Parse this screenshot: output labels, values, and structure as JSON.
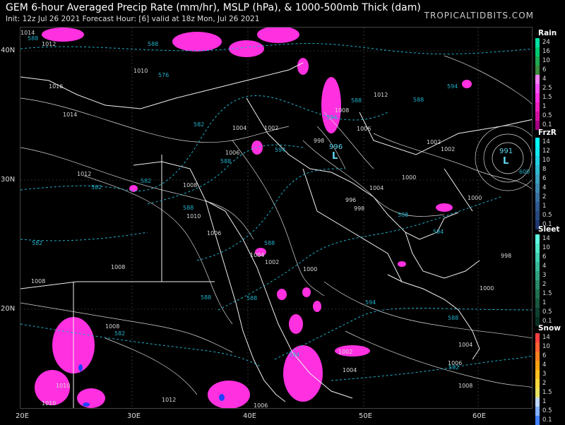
{
  "header": {
    "title": "GEM 6-hour Averaged Precip Rate (mm/hr), MSLP (hPa), & 1000-500mb Thick (dam)",
    "subtitle": "Init: 12z Jul 26 2021   Forecast Hour: [6]   valid at 18z Mon, Jul 26 2021",
    "brand": "TROPICALTIDBITS.COM"
  },
  "axes": {
    "lat_labels": [
      "40N",
      "30N",
      "20N"
    ],
    "lon_labels": [
      "20E",
      "30E",
      "40E",
      "50E",
      "60E"
    ]
  },
  "map_labels": {
    "pressure": [
      "1014",
      "1012",
      "1010",
      "1016",
      "1014",
      "1008",
      "1006",
      "1004",
      "1002",
      "1000",
      "998",
      "996",
      "1002",
      "1000",
      "1004",
      "1006",
      "1008",
      "1010",
      "1012",
      "1012",
      "1008",
      "1006",
      "1004",
      "1002",
      "1000",
      "998",
      "998",
      "1000",
      "1008",
      "1006",
      "1010",
      "1012",
      "1008",
      "1010",
      "1006",
      "1008",
      "1002",
      "1004",
      "1004",
      "1002"
    ],
    "thickness": [
      "576",
      "588",
      "582",
      "588",
      "582",
      "588",
      "594",
      "588",
      "594",
      "588",
      "594",
      "588",
      "582",
      "588",
      "594",
      "600",
      "588",
      "594",
      "588",
      "582",
      "582",
      "588",
      "594",
      "588",
      "582"
    ],
    "low_centers": [
      {
        "symbol": "L",
        "value": "996"
      },
      {
        "symbol": "L",
        "value": "991"
      }
    ]
  },
  "legends": [
    {
      "title": "Rain",
      "ticks": [
        "24",
        "16",
        "10",
        "6",
        "4",
        "2.5",
        "1.5",
        "1",
        "0.5",
        "0.1"
      ],
      "colors": [
        "#00e0a0",
        "#00c870",
        "#20a850",
        "#3c8a3c",
        "#ff80ff",
        "#ff50ff",
        "#ff30e0",
        "#f020c0",
        "#d010a0",
        "#a00080"
      ]
    },
    {
      "title": "FrzR",
      "ticks": [
        "14",
        "12",
        "10",
        "8",
        "6",
        "4",
        "2",
        "1",
        "0.5",
        "0.1"
      ],
      "colors": [
        "#00ffff",
        "#10e8f0",
        "#20d0e0",
        "#30b8d0",
        "#3aa0c0",
        "#3c88b0",
        "#3870a0",
        "#305a90",
        "#284880",
        "#203870"
      ]
    },
    {
      "title": "Sleet",
      "ticks": [
        "14",
        "10",
        "6",
        "4",
        "3",
        "2",
        "1.5",
        "1",
        "0.5",
        "0.1"
      ],
      "colors": [
        "#60ffe0",
        "#50e8c8",
        "#40d0b0",
        "#38b898",
        "#30a080",
        "#288868",
        "#207050",
        "#185840",
        "#104030",
        "#083020"
      ]
    },
    {
      "title": "Snow",
      "ticks": [
        "14",
        "10",
        "6",
        "4",
        "3",
        "2",
        "1.5",
        "1",
        "0.5",
        "0.1"
      ],
      "colors": [
        "#ff4040",
        "#ff6030",
        "#ff8020",
        "#ffa010",
        "#ffc020",
        "#ffd840",
        "#e8e060",
        "#c0d8ff",
        "#80b0ff",
        "#4080ff"
      ]
    }
  ],
  "colors": {
    "background": "#000000",
    "isobar": "#d8d8d8",
    "thickness": "#20b0c8",
    "border": "#f0f0f0",
    "precip": "#ff30e0"
  }
}
